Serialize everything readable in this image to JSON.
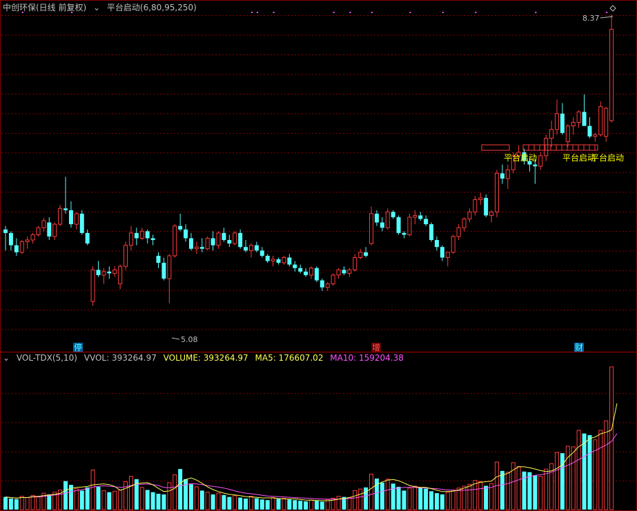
{
  "header": {
    "stock_title": "中创环保(日线 前复权)",
    "indicator_name": "平台启动(6,80,95,250)"
  },
  "price_labels": {
    "high": "8.37",
    "low": "5.08"
  },
  "markers": [
    "停",
    "增",
    "财"
  ],
  "signals": [
    "平台启动",
    "平台启动",
    "平台启动"
  ],
  "volume_header": {
    "name": "VOL-TDX(5,10)",
    "vvol": "VVOL: 393264.97",
    "volume": "VOLUME: 393264.97",
    "ma5": "MA5: 176607.02",
    "ma10": "MA10: 159204.38"
  },
  "colors": {
    "up": "#ff3c3c",
    "down": "#54ffff",
    "grid": "#8b0000",
    "ma5": "#ffff54",
    "ma10": "#ff54ff",
    "signal": "#ffff00",
    "text": "#c0c0c0"
  },
  "chart_data": {
    "type": "candlestick",
    "price_range": [
      4.7,
      8.37
    ],
    "candles": [
      [
        5.92,
        5.96,
        5.68,
        5.88
      ],
      [
        5.88,
        5.9,
        5.68,
        5.74
      ],
      [
        5.74,
        5.82,
        5.62,
        5.66
      ],
      [
        5.66,
        5.8,
        5.64,
        5.78
      ],
      [
        5.78,
        5.84,
        5.7,
        5.8
      ],
      [
        5.8,
        5.88,
        5.76,
        5.86
      ],
      [
        5.86,
        5.96,
        5.84,
        5.94
      ],
      [
        5.94,
        6.05,
        5.9,
        6.02
      ],
      [
        6.0,
        6.06,
        5.8,
        5.84
      ],
      [
        5.84,
        6.0,
        5.8,
        5.98
      ],
      [
        5.98,
        6.2,
        5.96,
        6.16
      ],
      [
        6.16,
        6.52,
        6.1,
        6.14
      ],
      [
        6.14,
        6.24,
        5.94,
        5.98
      ],
      [
        5.98,
        6.12,
        5.92,
        6.1
      ],
      [
        6.1,
        6.14,
        5.86,
        5.88
      ],
      [
        5.88,
        5.92,
        5.74,
        5.76
      ],
      [
        5.1,
        5.5,
        5.05,
        5.46
      ],
      [
        5.46,
        5.56,
        5.38,
        5.4
      ],
      [
        5.4,
        5.48,
        5.3,
        5.44
      ],
      [
        5.44,
        5.5,
        5.36,
        5.42
      ],
      [
        5.42,
        5.5,
        5.38,
        5.46
      ],
      [
        5.3,
        5.52,
        5.24,
        5.5
      ],
      [
        5.5,
        5.78,
        5.46,
        5.74
      ],
      [
        5.74,
        5.96,
        5.68,
        5.88
      ],
      [
        5.88,
        5.94,
        5.74,
        5.82
      ],
      [
        5.82,
        5.94,
        5.8,
        5.9
      ],
      [
        5.9,
        5.92,
        5.76,
        5.82
      ],
      [
        5.82,
        5.86,
        5.74,
        5.8
      ],
      [
        5.62,
        5.66,
        5.48,
        5.54
      ],
      [
        5.54,
        5.6,
        5.34,
        5.36
      ],
      [
        5.36,
        5.64,
        5.08,
        5.62
      ],
      [
        5.62,
        5.98,
        5.6,
        5.96
      ],
      [
        5.96,
        6.1,
        5.9,
        5.92
      ],
      [
        5.92,
        5.98,
        5.78,
        5.82
      ],
      [
        5.82,
        5.88,
        5.68,
        5.7
      ],
      [
        5.7,
        5.78,
        5.64,
        5.72
      ],
      [
        5.72,
        5.82,
        5.66,
        5.7
      ],
      [
        5.7,
        5.84,
        5.68,
        5.82
      ],
      [
        5.82,
        5.9,
        5.68,
        5.74
      ],
      [
        5.74,
        5.9,
        5.7,
        5.88
      ],
      [
        5.88,
        5.94,
        5.78,
        5.8
      ],
      [
        5.8,
        5.86,
        5.72,
        5.76
      ],
      [
        5.76,
        5.9,
        5.74,
        5.88
      ],
      [
        5.88,
        5.92,
        5.7,
        5.72
      ],
      [
        5.72,
        5.8,
        5.66,
        5.68
      ],
      [
        5.68,
        5.76,
        5.6,
        5.74
      ],
      [
        5.74,
        5.78,
        5.66,
        5.68
      ],
      [
        5.68,
        5.72,
        5.6,
        5.62
      ],
      [
        5.62,
        5.64,
        5.54,
        5.56
      ],
      [
        5.56,
        5.62,
        5.5,
        5.58
      ],
      [
        5.58,
        5.6,
        5.52,
        5.54
      ],
      [
        5.54,
        5.62,
        5.52,
        5.6
      ],
      [
        5.6,
        5.64,
        5.5,
        5.52
      ],
      [
        5.52,
        5.56,
        5.44,
        5.48
      ],
      [
        5.48,
        5.52,
        5.42,
        5.44
      ],
      [
        5.44,
        5.48,
        5.38,
        5.4
      ],
      [
        5.4,
        5.5,
        5.36,
        5.48
      ],
      [
        5.48,
        5.5,
        5.32,
        5.34
      ],
      [
        5.34,
        5.36,
        5.22,
        5.26
      ],
      [
        5.26,
        5.32,
        5.22,
        5.3
      ],
      [
        5.3,
        5.42,
        5.28,
        5.4
      ],
      [
        5.4,
        5.48,
        5.36,
        5.46
      ],
      [
        5.46,
        5.5,
        5.4,
        5.42
      ],
      [
        5.42,
        5.48,
        5.38,
        5.46
      ],
      [
        5.46,
        5.64,
        5.44,
        5.6
      ],
      [
        5.6,
        5.7,
        5.58,
        5.66
      ],
      [
        5.66,
        5.72,
        5.6,
        5.62
      ],
      [
        5.76,
        6.18,
        5.74,
        6.1
      ],
      [
        6.1,
        6.14,
        5.96,
        6.0
      ],
      [
        6.0,
        6.06,
        5.9,
        5.94
      ],
      [
        5.94,
        6.16,
        5.92,
        6.12
      ],
      [
        6.12,
        6.14,
        6.04,
        6.06
      ],
      [
        6.06,
        6.08,
        5.86,
        5.88
      ],
      [
        5.88,
        5.9,
        5.82,
        5.86
      ],
      [
        5.86,
        6.1,
        5.84,
        6.06
      ],
      [
        6.06,
        6.14,
        5.98,
        6.08
      ],
      [
        6.08,
        6.12,
        6.02,
        6.04
      ],
      [
        6.04,
        6.08,
        5.96,
        5.98
      ],
      [
        5.98,
        6.0,
        5.78,
        5.8
      ],
      [
        5.8,
        5.84,
        5.68,
        5.72
      ],
      [
        5.72,
        5.74,
        5.56,
        5.6
      ],
      [
        5.6,
        5.64,
        5.5,
        5.66
      ],
      [
        5.66,
        5.86,
        5.64,
        5.84
      ],
      [
        5.84,
        5.98,
        5.8,
        5.94
      ],
      [
        5.94,
        6.06,
        5.9,
        6.04
      ],
      [
        6.04,
        6.16,
        6.0,
        6.12
      ],
      [
        6.12,
        6.3,
        6.08,
        6.26
      ],
      [
        6.26,
        6.34,
        6.2,
        6.28
      ],
      [
        6.28,
        6.32,
        6.06,
        6.08
      ],
      [
        6.08,
        6.14,
        6.0,
        6.12
      ],
      [
        6.12,
        6.6,
        6.06,
        6.56
      ],
      [
        6.56,
        6.66,
        6.44,
        6.5
      ],
      [
        6.5,
        6.66,
        6.38,
        6.6
      ],
      [
        6.6,
        6.8,
        6.56,
        6.76
      ],
      [
        6.76,
        6.88,
        6.7,
        6.8
      ],
      [
        6.8,
        6.84,
        6.66,
        6.7
      ],
      [
        6.7,
        6.74,
        6.58,
        6.66
      ],
      [
        6.66,
        6.72,
        6.44,
        6.64
      ],
      [
        6.64,
        6.8,
        6.6,
        6.76
      ],
      [
        6.76,
        7.0,
        6.7,
        6.96
      ],
      [
        6.96,
        7.16,
        6.86,
        7.06
      ],
      [
        7.06,
        7.4,
        7.0,
        7.24
      ],
      [
        7.24,
        7.36,
        7.0,
        7.02
      ],
      [
        6.92,
        7.12,
        6.86,
        7.1
      ],
      [
        7.1,
        7.2,
        7.0,
        7.14
      ],
      [
        7.14,
        7.28,
        7.08,
        7.26
      ],
      [
        7.26,
        7.46,
        7.2,
        7.1
      ],
      [
        7.1,
        7.2,
        6.96,
        6.98
      ],
      [
        6.98,
        7.02,
        6.92,
        7.0
      ],
      [
        7.0,
        7.38,
        6.98,
        7.32
      ],
      [
        6.98,
        7.32,
        6.92,
        7.3
      ],
      [
        7.16,
        8.37,
        7.14,
        8.2
      ]
    ],
    "volume": [
      40,
      35,
      33,
      42,
      38,
      45,
      40,
      52,
      48,
      55,
      62,
      90,
      78,
      66,
      60,
      70,
      125,
      72,
      60,
      55,
      58,
      62,
      88,
      105,
      96,
      70,
      62,
      55,
      50,
      48,
      85,
      110,
      128,
      96,
      80,
      72,
      60,
      55,
      48,
      52,
      46,
      40,
      44,
      38,
      35,
      42,
      36,
      32,
      30,
      38,
      34,
      36,
      32,
      30,
      28,
      26,
      30,
      28,
      25,
      32,
      36,
      42,
      40,
      38,
      60,
      65,
      70,
      112,
      98,
      85,
      96,
      82,
      72,
      60,
      68,
      74,
      70,
      66,
      58,
      52,
      48,
      55,
      62,
      68,
      74,
      80,
      92,
      88,
      75,
      82,
      150,
      122,
      118,
      148,
      136,
      120,
      118,
      108,
      105,
      128,
      145,
      180,
      178,
      200,
      198,
      250,
      240,
      235,
      220,
      250,
      280,
      450
    ],
    "volume_ma5": [
      40,
      38,
      36,
      38,
      38,
      41,
      42,
      44,
      46,
      48,
      51,
      61,
      67,
      70,
      71,
      73,
      78,
      80,
      81,
      79,
      73,
      61,
      67,
      74,
      82,
      84,
      85,
      78,
      67,
      57,
      59,
      67,
      84,
      95,
      100,
      93,
      83,
      72,
      63,
      57,
      52,
      48,
      46,
      44,
      41,
      40,
      39,
      37,
      37,
      37,
      35,
      34,
      34,
      34,
      32,
      30,
      30,
      29,
      28,
      28,
      30,
      33,
      35,
      38,
      43,
      49,
      55,
      67,
      79,
      87,
      93,
      95,
      91,
      84,
      76,
      72,
      70,
      70,
      66,
      61,
      57,
      57,
      58,
      62,
      68,
      74,
      82,
      86,
      88,
      90,
      104,
      109,
      114,
      125,
      135,
      135,
      132,
      128,
      123,
      120,
      122,
      130,
      141,
      165,
      180,
      199,
      209,
      224,
      229,
      239,
      244,
      251,
      335
    ],
    "volume_ma10": [
      40,
      38,
      36,
      38,
      38,
      40,
      40,
      42,
      44,
      46,
      48,
      52,
      56,
      60,
      63,
      66,
      71,
      74,
      75,
      74,
      72,
      70,
      72,
      76,
      80,
      80,
      81,
      79,
      76,
      70,
      69,
      71,
      75,
      79,
      82,
      81,
      79,
      76,
      73,
      71,
      68,
      64,
      59,
      55,
      52,
      50,
      48,
      45,
      43,
      42,
      41,
      40,
      39,
      38,
      37,
      36,
      35,
      34,
      33,
      33,
      33,
      33,
      34,
      35,
      37,
      40,
      43,
      48,
      53,
      58,
      62,
      66,
      68,
      70,
      70,
      70,
      69,
      68,
      67,
      66,
      64,
      62,
      61,
      60,
      61,
      62,
      64,
      66,
      68,
      70,
      76,
      79,
      82,
      88,
      94,
      100,
      104,
      108,
      110,
      113,
      118,
      125,
      132,
      140,
      148,
      158,
      167,
      178,
      186,
      195,
      204,
      215,
      240
    ]
  }
}
